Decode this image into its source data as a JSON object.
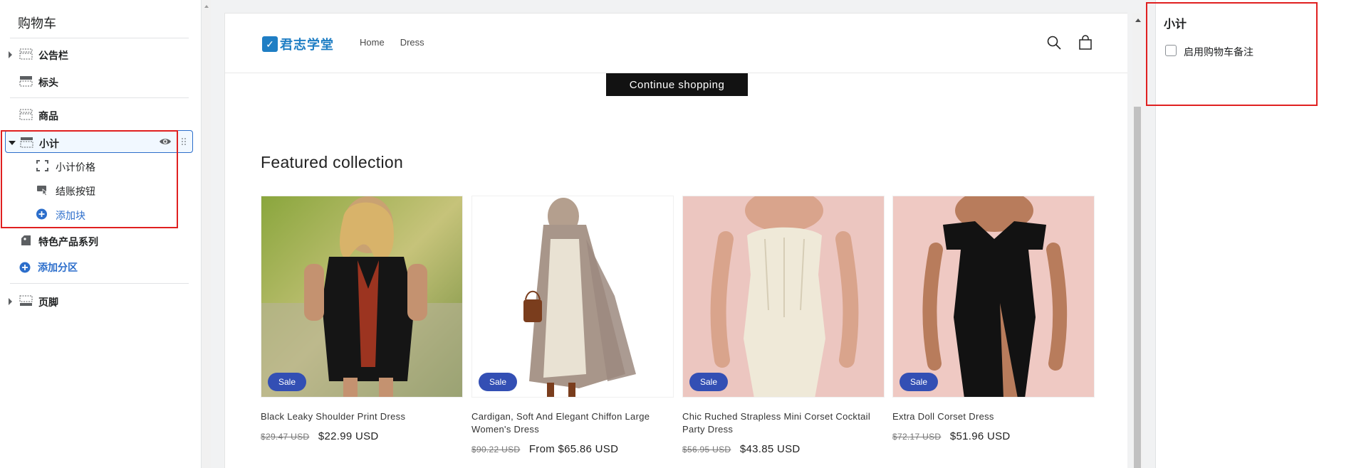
{
  "sidebar": {
    "title": "购物车",
    "items": [
      {
        "label": "公告栏",
        "icon": "section-icon"
      },
      {
        "label": "标头",
        "icon": "header-icon"
      },
      {
        "label": "商品",
        "icon": "section-icon"
      },
      {
        "label": "小计",
        "icon": "section-icon"
      },
      {
        "label": "特色产品系列",
        "icon": "tag-icon"
      },
      {
        "label": "页脚",
        "icon": "section-icon"
      }
    ],
    "subitems": [
      {
        "label": "小计价格",
        "icon": "crop-icon"
      },
      {
        "label": "结账按钮",
        "icon": "cursor-button-icon"
      },
      {
        "label": "添加块",
        "icon": "plus-circle-icon"
      }
    ],
    "add_section_label": "添加分区"
  },
  "preview": {
    "logo_mark": "✓",
    "logo_text": "君志学堂",
    "nav": [
      "Home",
      "Dress"
    ],
    "continue_label": "Continue shopping",
    "featured_title": "Featured collection",
    "products": [
      {
        "name": "Black Leaky Shoulder Print Dress",
        "old_price": "$29.47 USD",
        "price": "$22.99 USD",
        "badge": "Sale"
      },
      {
        "name": "Cardigan, Soft And Elegant Chiffon Large Women's Dress",
        "old_price": "$90.22 USD",
        "price": "From $65.86 USD",
        "badge": "Sale"
      },
      {
        "name": "Chic Ruched Strapless Mini Corset Cocktail Party Dress",
        "old_price": "$56.95 USD",
        "price": "$43.85 USD",
        "badge": "Sale"
      },
      {
        "name": "Extra Doll Corset Dress",
        "old_price": "$72.17 USD",
        "price": "$51.96 USD",
        "badge": "Sale"
      }
    ]
  },
  "settings": {
    "title": "小计",
    "checkbox_label": "启用购物车备注",
    "checkbox_checked": false
  },
  "colors": {
    "accent": "#2c6ecb",
    "sale_badge": "#334fb4",
    "highlight": "#e02020",
    "logo": "#1f7ec4"
  }
}
